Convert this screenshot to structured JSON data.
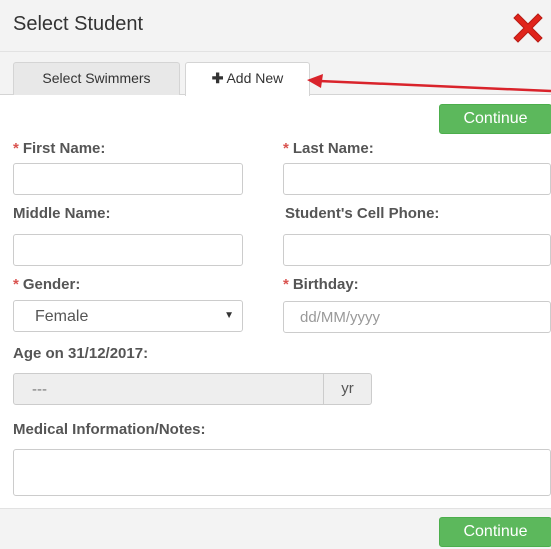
{
  "dialog": {
    "title": "Select Student",
    "close_icon": "close-x-icon",
    "accent_close": "#e0241b"
  },
  "tabs": [
    {
      "label": "Select Swimmers",
      "active": false
    },
    {
      "plus": "✚",
      "label": "Add New",
      "active": true
    }
  ],
  "buttons": {
    "continue_label": "Continue",
    "color": "#5cb85c"
  },
  "form": {
    "required_mark": "*",
    "first_name_label": "First Name:",
    "last_name_label": "Last Name:",
    "middle_name_label": "Middle Name:",
    "cell_phone_label": "Student's Cell Phone:",
    "gender_label": "Gender:",
    "gender_value": "Female",
    "birthday_label": "Birthday:",
    "birthday_placeholder": "dd/MM/yyyy",
    "age_label": "Age on 31/12/2017:",
    "age_value": "---",
    "age_unit": "yr",
    "notes_label": "Medical Information/Notes:"
  },
  "annotation": {
    "arrow_color": "#d9232b"
  }
}
